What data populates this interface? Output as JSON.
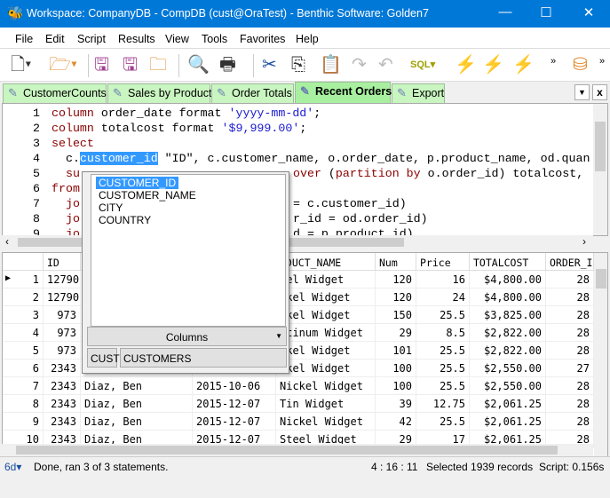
{
  "window": {
    "title": "Workspace: CompanyDB - CompDB (cust@OraTest) - Benthic Software: Golden7",
    "minimize": "—",
    "maximize": "☐",
    "close": "✕"
  },
  "menu": [
    "File",
    "Edit",
    "Script",
    "Results",
    "View",
    "Tools",
    "Favorites",
    "Help"
  ],
  "toolbar": {
    "more1": "»",
    "more2": "»"
  },
  "tabs": [
    "CustomerCounts",
    "Sales by Product",
    "Order Totals",
    "Recent Orders",
    "Export"
  ],
  "active_tab": "Recent Orders",
  "editor": {
    "lines": [
      {
        "n": "1",
        "parts": [
          [
            "kw",
            "column"
          ],
          [
            "",
            " order_date format "
          ],
          [
            "str",
            "'yyyy-mm-dd'"
          ],
          [
            "",
            ";"
          ]
        ]
      },
      {
        "n": "2",
        "parts": [
          [
            "kw",
            "column"
          ],
          [
            "",
            " totalcost format "
          ],
          [
            "str",
            "'$9,999.00'"
          ],
          [
            "",
            ";"
          ]
        ]
      },
      {
        "n": "3",
        "parts": [
          [
            "kw",
            "select"
          ]
        ]
      },
      {
        "n": "4",
        "parts": [
          [
            "",
            "  c."
          ],
          [
            "sel",
            "customer_id"
          ],
          [
            "",
            " \"ID\", c.customer_name, o.order_date, p.product_name, od.quan"
          ]
        ]
      },
      {
        "n": "5",
        "parts": [
          [
            "kw",
            "  su"
          ]
        ],
        "right": [
          [
            "kw",
            "over"
          ],
          [
            "",
            " ("
          ],
          [
            "kw",
            "partition by"
          ],
          [
            "",
            " o.order_id) totalcost,"
          ]
        ]
      },
      {
        "n": "6",
        "parts": [
          [
            "kw",
            "from"
          ]
        ]
      },
      {
        "n": "7",
        "parts": [
          [
            "kw",
            "  jo"
          ]
        ],
        "right": [
          [
            "",
            "= c.customer_id)"
          ]
        ]
      },
      {
        "n": "8",
        "parts": [
          [
            "kw",
            "  jo"
          ]
        ],
        "right": [
          [
            "",
            "r_id = od.order_id)"
          ]
        ]
      },
      {
        "n": "9",
        "parts": [
          [
            "kw",
            "  jo"
          ]
        ],
        "right": [
          [
            "",
            "d = p.product_id)"
          ]
        ]
      }
    ]
  },
  "autocomplete": {
    "items": [
      "CUSTOMER_ID",
      "CUSTOMER_NAME",
      "CITY",
      "COUNTRY"
    ],
    "selected": "CUSTOMER_ID",
    "columns_label": "Columns",
    "alias": "CUST",
    "table": "CUSTOMERS"
  },
  "grid": {
    "headers": [
      "ID",
      "",
      "",
      "ODUCT_NAME",
      "Num",
      "Price",
      "TOTALCOST",
      "ORDER_I"
    ],
    "rows": [
      [
        "1",
        "12790",
        "",
        "",
        "eel Widget",
        "120",
        "16",
        "$4,800.00",
        "28"
      ],
      [
        "2",
        "12790",
        "",
        "",
        "ckel Widget",
        "120",
        "24",
        "$4,800.00",
        "28"
      ],
      [
        "3",
        "973",
        "",
        "",
        "ckel Widget",
        "150",
        "25.5",
        "$3,825.00",
        "28"
      ],
      [
        "4",
        "973",
        "",
        "",
        "atinum Widget",
        "29",
        "8.5",
        "$2,822.00",
        "28"
      ],
      [
        "5",
        "973",
        "",
        "",
        "ckel Widget",
        "101",
        "25.5",
        "$2,822.00",
        "28"
      ],
      [
        "6",
        "2343",
        "",
        "",
        "ckel Widget",
        "100",
        "25.5",
        "$2,550.00",
        "27"
      ],
      [
        "7",
        "2343",
        "Diaz, Ben",
        "2015-10-06",
        "Nickel Widget",
        "100",
        "25.5",
        "$2,550.00",
        "28"
      ],
      [
        "8",
        "2343",
        "Diaz, Ben",
        "2015-12-07",
        "Tin Widget",
        "39",
        "12.75",
        "$2,061.25",
        "28"
      ],
      [
        "9",
        "2343",
        "Diaz, Ben",
        "2015-12-07",
        "Nickel Widget",
        "42",
        "25.5",
        "$2,061.25",
        "28"
      ],
      [
        "10",
        "2343",
        "Diaz, Ben",
        "2015-12-07",
        "Steel Widget",
        "29",
        "17",
        "$2,061.25",
        "28"
      ]
    ]
  },
  "status": {
    "message": "Done, ran 3 of 3 statements.",
    "position": "4 : 16 : 11",
    "records": "Selected 1939 records",
    "time": "Script: 0.156s"
  }
}
